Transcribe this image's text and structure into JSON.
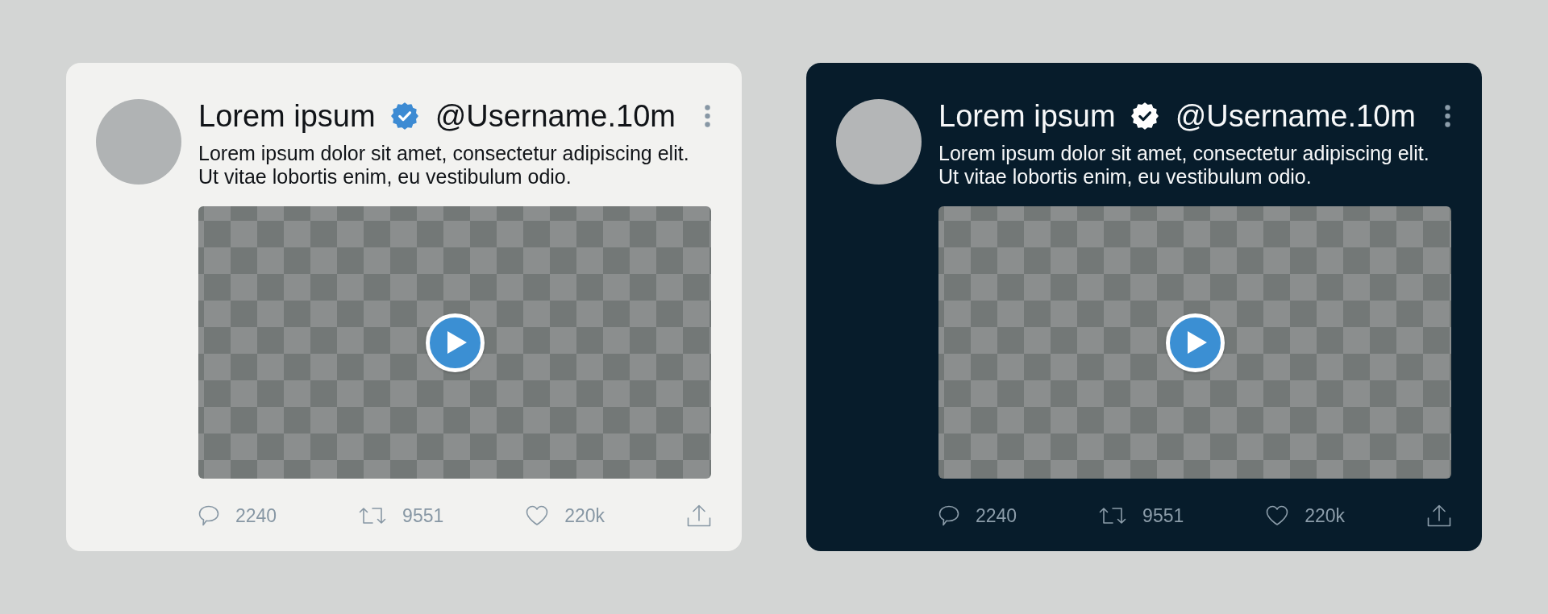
{
  "posts": [
    {
      "kind": "light",
      "author": "Lorem ipsum",
      "verified": true,
      "handle": "@Username.10m",
      "text": "Lorem ipsum dolor sit amet, consectetur adipiscing elit.\nUt vitae lobortis enim, eu vestibulum odio.",
      "actions": [
        {
          "kind": "reply",
          "count": "2240"
        },
        {
          "kind": "repost",
          "count": "9551"
        },
        {
          "kind": "like",
          "count": "220k"
        },
        {
          "kind": "share"
        }
      ]
    },
    {
      "kind": "dark",
      "author": "Lorem ipsum",
      "verified": true,
      "handle": "@Username.10m",
      "text": "Lorem ipsum dolor sit amet, consectetur adipiscing elit.\nUt vitae lobortis enim, eu vestibulum odio.",
      "actions": [
        {
          "kind": "reply",
          "count": "2240"
        },
        {
          "kind": "repost",
          "count": "9551"
        },
        {
          "kind": "like",
          "count": "220k"
        },
        {
          "kind": "share"
        }
      ]
    }
  ]
}
